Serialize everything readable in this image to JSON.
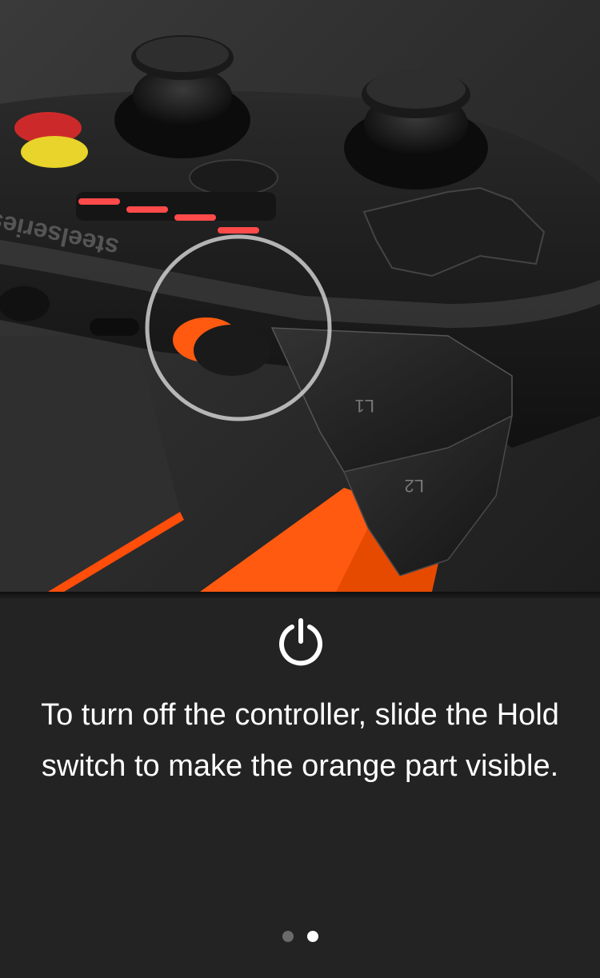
{
  "hero": {
    "button_labels": {
      "l1": "L1",
      "l2": "L2"
    },
    "brand_text": "steelseries",
    "player_numbers": [
      "1",
      "2",
      "3",
      "4"
    ],
    "colors": {
      "accent_orange": "#ff5a10",
      "highlight_ring": "#d9d9d9"
    }
  },
  "icon": {
    "name": "power-icon"
  },
  "instruction": {
    "text": "To turn off the controller, slide the Hold switch to make the orange part visible."
  },
  "pager": {
    "total": 2,
    "current": 2
  },
  "colors": {
    "background": "#232323",
    "text": "#ffffff",
    "dot_inactive": "#6a6a6a",
    "dot_active": "#ffffff"
  }
}
